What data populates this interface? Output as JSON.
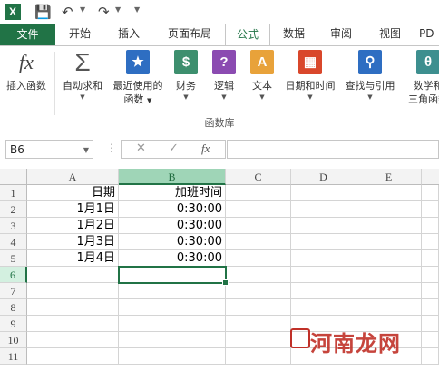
{
  "quick_access": {
    "app_icon": "X"
  },
  "tabs": [
    {
      "label": "文件"
    },
    {
      "label": "开始"
    },
    {
      "label": "插入"
    },
    {
      "label": "页面布局"
    },
    {
      "label": "公式"
    },
    {
      "label": "数据"
    },
    {
      "label": "审阅"
    },
    {
      "label": "视图"
    },
    {
      "label": "PD"
    }
  ],
  "ribbon": {
    "group_label": "函数库",
    "buttons": [
      {
        "line1": "插入函数",
        "line2": ""
      },
      {
        "line1": "自动求和",
        "line2": ""
      },
      {
        "line1": "最近使用的",
        "line2": "函数"
      },
      {
        "line1": "财务",
        "line2": ""
      },
      {
        "line1": "逻辑",
        "line2": ""
      },
      {
        "line1": "文本",
        "line2": ""
      },
      {
        "line1": "日期和时间",
        "line2": ""
      },
      {
        "line1": "查找与引用",
        "line2": ""
      },
      {
        "line1": "数学和",
        "line2": "三角函数"
      }
    ]
  },
  "formula_bar": {
    "name_box": "B6",
    "fx": "fx",
    "value": ""
  },
  "columns": [
    "A",
    "B",
    "C",
    "D",
    "E"
  ],
  "rows": [
    "1",
    "2",
    "3",
    "4",
    "5",
    "6",
    "7",
    "8",
    "9",
    "10",
    "11"
  ],
  "cells": {
    "A1": "日期",
    "B1": "加班时间",
    "A2": "1月1日",
    "B2": "0:30:00",
    "A3": "1月2日",
    "B3": "0:30:00",
    "A4": "1月3日",
    "B4": "0:30:00",
    "A5": "1月4日",
    "B5": "0:30:00"
  },
  "selected_cell": "B6",
  "watermark": "河南龙网",
  "colors": {
    "accent": "#217346",
    "selected_header": "#9fd5b7"
  }
}
